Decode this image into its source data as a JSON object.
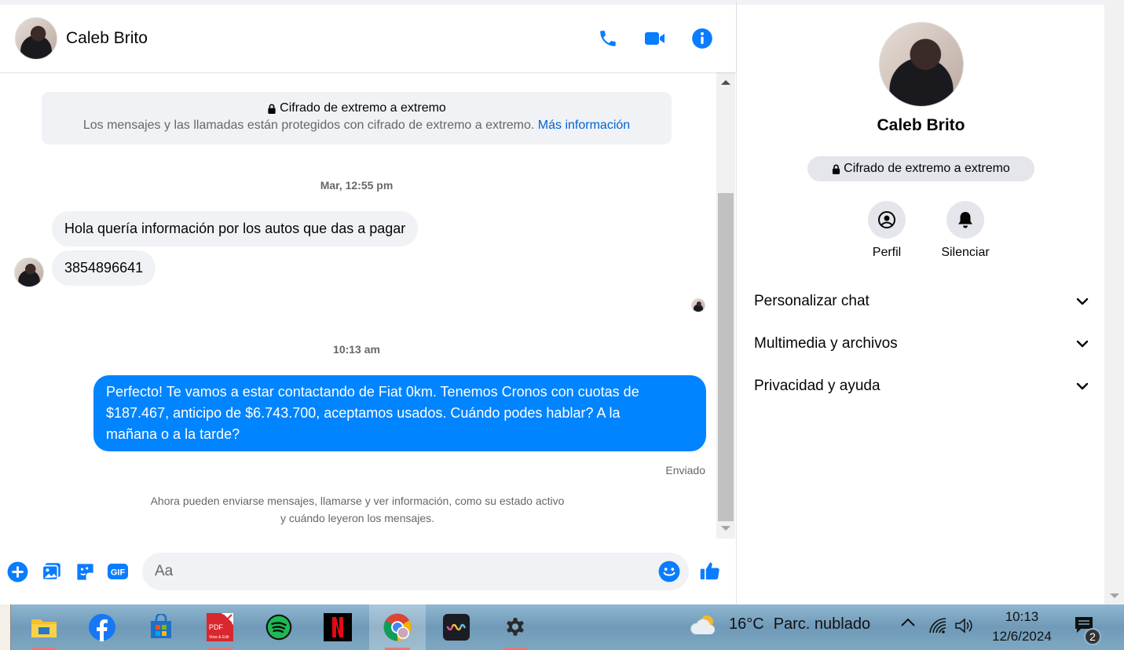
{
  "header": {
    "contact_name": "Caleb Brito"
  },
  "encryption_notice": {
    "title": "Cifrado de extremo a extremo",
    "text": "Los mensajes y las llamadas están protegidos con cifrado de extremo a extremo.",
    "link": "Más información"
  },
  "thread": {
    "timestamp_1": "Mar, 12:55 pm",
    "incoming_1": "Hola quería información por los autos que das a pagar",
    "incoming_2": "3854896641",
    "timestamp_2": "10:13 am",
    "outgoing_1_line1": "Perfecto! Te vamos a estar contactando de Fiat 0km. Tenemos Cronos con cuotas de",
    "outgoing_1_line2": "$187.467, anticipo de $6.743.700, aceptamos usados. Cuándo podes hablar? A la",
    "outgoing_1_line3": "mañana o a la tarde?",
    "sent_status": "Enviado",
    "footer_line1": "Ahora pueden enviarse mensajes, llamarse y ver información, como su estado activo",
    "footer_line2": "y cuándo leyeron los mensajes."
  },
  "composer": {
    "placeholder": "Aa"
  },
  "right_panel": {
    "name": "Caleb Brito",
    "badge": "Cifrado de extremo a extremo",
    "actions": [
      {
        "label": "Perfil"
      },
      {
        "label": "Silenciar"
      }
    ],
    "sections": [
      {
        "label": "Personalizar chat"
      },
      {
        "label": "Multimedia y archivos"
      },
      {
        "label": "Privacidad y ayuda"
      }
    ]
  },
  "taskbar": {
    "weather_temp": "16°C",
    "weather_desc": "Parc. nublado",
    "time": "10:13",
    "date": "12/6/2024",
    "notification_count": "2",
    "apps": [
      "file-explorer",
      "facebook",
      "microsoft-store",
      "pdf-editor",
      "spotify",
      "netflix",
      "chrome",
      "wave-app",
      "settings"
    ]
  },
  "colors": {
    "accent": "#0084ff",
    "icon_blue": "#0a7cff",
    "bubble_in": "#f0f2f5"
  }
}
